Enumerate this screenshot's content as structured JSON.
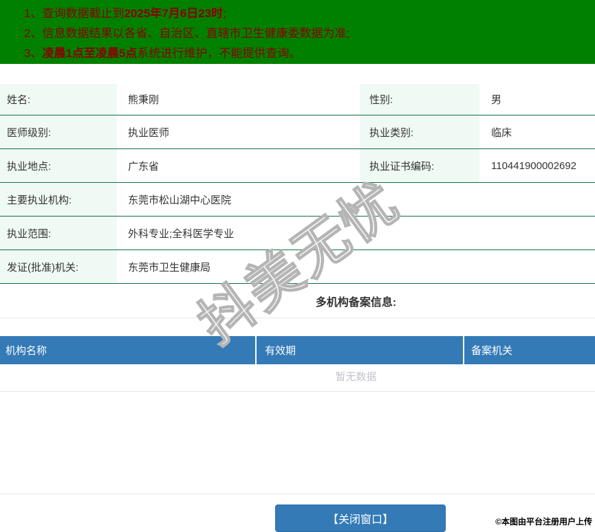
{
  "banner": {
    "notices": [
      {
        "num": "1、",
        "pre": "查询数据截止到",
        "bold": "2025年7月6日23时",
        "post": ";"
      },
      {
        "num": "2、",
        "pre": "信息数据结果以各省、自治区、直辖市卫生健康委数据为准;",
        "bold": "",
        "post": ""
      },
      {
        "num": "3、",
        "pre": "",
        "bold": "凌晨1点至凌晨5点",
        "post": "系统进行维护，不能提供查询。"
      }
    ]
  },
  "doctor": {
    "rows_double": [
      {
        "label1": "姓名:",
        "value1": "熊秉刚",
        "label2": "性别:",
        "value2": "男"
      },
      {
        "label1": "医师级别:",
        "value1": "执业医师",
        "label2": "执业类别:",
        "value2": "临床"
      },
      {
        "label1": "执业地点:",
        "value1": "广东省",
        "label2": "执业证书编码:",
        "value2": "110441900002692"
      }
    ],
    "rows_single": [
      {
        "label": "主要执业机构:",
        "value": "东莞市松山湖中心医院"
      },
      {
        "label": "执业范围:",
        "value": "外科专业;全科医学专业"
      },
      {
        "label": "发证(批准)机关:",
        "value": "东莞市卫生健康局"
      }
    ]
  },
  "filing": {
    "heading": "多机构备案信息:",
    "columns": [
      "机构名称",
      "有效期",
      "备案机关"
    ],
    "empty_text": "暂无数据"
  },
  "footer": {
    "close_button": "【关闭窗口】"
  },
  "watermarks": {
    "diagonal": "抖美无忧",
    "stamp": "©本图由平台注册用户上传"
  },
  "colors": {
    "banner_green": "#008000",
    "notice_red": "#8b0000",
    "row_border_green": "#116e41",
    "label_bg_mint": "#f0faf4",
    "accent_blue": "#337ab7",
    "empty_text_gray": "#c0c4cc"
  }
}
